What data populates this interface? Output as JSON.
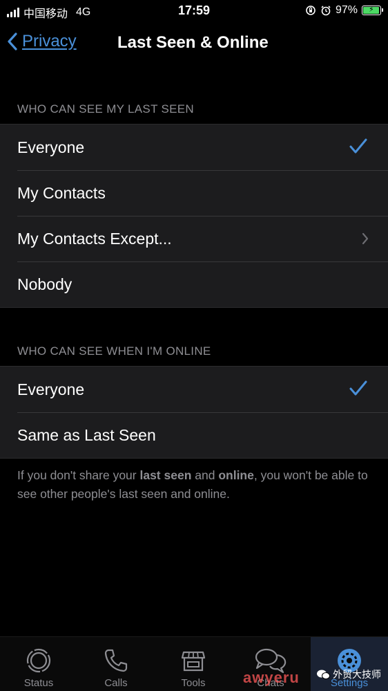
{
  "status_bar": {
    "carrier": "中国移动",
    "network": "4G",
    "time": "17:59",
    "battery": "97%",
    "battery_level": 0.97
  },
  "nav": {
    "back_label": "Privacy",
    "title": "Last Seen & Online"
  },
  "last_seen": {
    "header": "WHO CAN SEE MY LAST SEEN",
    "options": [
      {
        "label": "Everyone",
        "selected": true
      },
      {
        "label": "My Contacts",
        "selected": false
      },
      {
        "label": "My Contacts Except...",
        "selected": false
      },
      {
        "label": "Nobody",
        "selected": false
      }
    ]
  },
  "online": {
    "header": "WHO CAN SEE WHEN I'M ONLINE",
    "options": [
      {
        "label": "Everyone",
        "selected": true
      },
      {
        "label": "Same as Last Seen",
        "selected": false
      }
    ]
  },
  "footer": {
    "part1": "If you don't share your ",
    "bold1": "last seen",
    "part2": " and ",
    "bold2": "online",
    "part3": ", you won't be able to see other people's last seen and online."
  },
  "tab_bar": {
    "tabs": [
      {
        "label": "Status",
        "icon": "status-icon"
      },
      {
        "label": "Calls",
        "icon": "phone-icon"
      },
      {
        "label": "Tools",
        "icon": "store-icon"
      },
      {
        "label": "Chats",
        "icon": "chat-bubbles-icon"
      },
      {
        "label": "Settings",
        "icon": "gear-icon",
        "active": true
      }
    ]
  },
  "watermark": {
    "brand": "awyeru",
    "account": "外贸大技师"
  },
  "colors": {
    "accent": "#4a90d9",
    "background": "#000000",
    "cell": "#1c1c1e",
    "secondary_text": "#8e8e93"
  }
}
